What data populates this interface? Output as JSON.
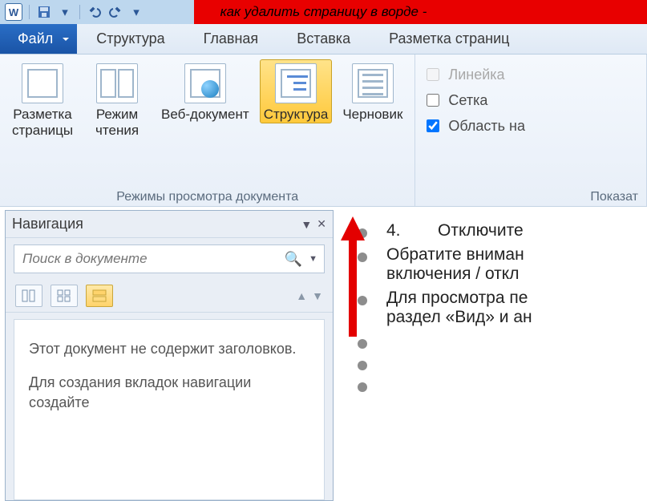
{
  "titlebar": {
    "doc_title": "как удалить страницу в ворде -"
  },
  "tabs": {
    "file": "Файл",
    "items": [
      "Структура",
      "Главная",
      "Вставка",
      "Разметка страниц"
    ]
  },
  "ribbon": {
    "views_group_label": "Режимы просмотра документа",
    "show_group_label": "Показат",
    "btn_page": "Разметка\nстраницы",
    "btn_read": "Режим\nчтения",
    "btn_web": "Веб-документ",
    "btn_outline": "Структура",
    "btn_draft": "Черновик",
    "chk_ruler": "Линейка",
    "chk_grid": "Сетка",
    "chk_navpane": "Область на"
  },
  "nav": {
    "title": "Навигация",
    "search_placeholder": "Поиск в документе",
    "empty1": "Этот документ не содержит заголовков.",
    "empty2": "Для создания вкладок навигации создайте"
  },
  "doc": {
    "lines": [
      {
        "num": "4.",
        "txt": "Отключите"
      },
      {
        "num": "",
        "txt": "Обратите вниман\nвключения / откл"
      },
      {
        "num": "",
        "txt": "Для просмотра пе\nраздел «Вид» и ан"
      },
      {
        "num": "",
        "txt": ""
      },
      {
        "num": "",
        "txt": ""
      },
      {
        "num": "",
        "txt": ""
      }
    ]
  }
}
